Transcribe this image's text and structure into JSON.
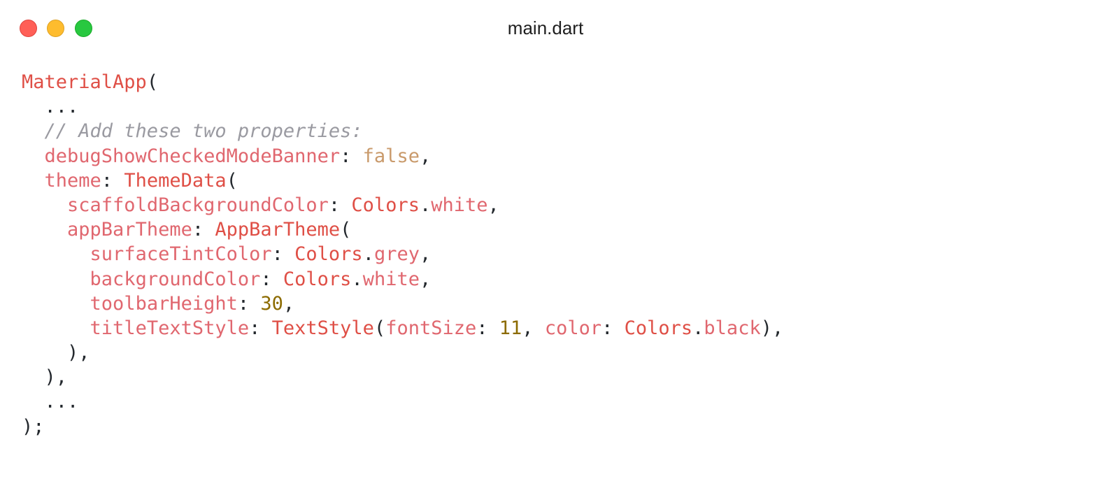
{
  "window": {
    "title": "main.dart"
  },
  "colors": {
    "close": "#ff5f57",
    "minimize": "#febc2e",
    "zoom": "#28c840",
    "class": "#df4f46",
    "property": "#e0676f",
    "comment": "#9a9aa1",
    "boolean": "#c99a6b",
    "number": "#8c6b00",
    "plain": "#24292e"
  },
  "code": {
    "lines": [
      [
        {
          "t": "MaterialApp",
          "c": "class"
        },
        {
          "t": "(",
          "c": "plain"
        }
      ],
      [
        {
          "t": "  ...",
          "c": "plain"
        }
      ],
      [
        {
          "t": "  // Add these two properties:",
          "c": "comment"
        }
      ],
      [
        {
          "t": "  ",
          "c": "plain"
        },
        {
          "t": "debugShowCheckedModeBanner",
          "c": "prop"
        },
        {
          "t": ": ",
          "c": "plain"
        },
        {
          "t": "false",
          "c": "bool"
        },
        {
          "t": ",",
          "c": "plain"
        }
      ],
      [
        {
          "t": "  ",
          "c": "plain"
        },
        {
          "t": "theme",
          "c": "prop"
        },
        {
          "t": ": ",
          "c": "plain"
        },
        {
          "t": "ThemeData",
          "c": "class"
        },
        {
          "t": "(",
          "c": "plain"
        }
      ],
      [
        {
          "t": "    ",
          "c": "plain"
        },
        {
          "t": "scaffoldBackgroundColor",
          "c": "prop"
        },
        {
          "t": ": ",
          "c": "plain"
        },
        {
          "t": "Colors",
          "c": "class"
        },
        {
          "t": ".",
          "c": "plain"
        },
        {
          "t": "white",
          "c": "member"
        },
        {
          "t": ",",
          "c": "plain"
        }
      ],
      [
        {
          "t": "    ",
          "c": "plain"
        },
        {
          "t": "appBarTheme",
          "c": "prop"
        },
        {
          "t": ": ",
          "c": "plain"
        },
        {
          "t": "AppBarTheme",
          "c": "class"
        },
        {
          "t": "(",
          "c": "plain"
        }
      ],
      [
        {
          "t": "      ",
          "c": "plain"
        },
        {
          "t": "surfaceTintColor",
          "c": "prop"
        },
        {
          "t": ": ",
          "c": "plain"
        },
        {
          "t": "Colors",
          "c": "class"
        },
        {
          "t": ".",
          "c": "plain"
        },
        {
          "t": "grey",
          "c": "member"
        },
        {
          "t": ",",
          "c": "plain"
        }
      ],
      [
        {
          "t": "      ",
          "c": "plain"
        },
        {
          "t": "backgroundColor",
          "c": "prop"
        },
        {
          "t": ": ",
          "c": "plain"
        },
        {
          "t": "Colors",
          "c": "class"
        },
        {
          "t": ".",
          "c": "plain"
        },
        {
          "t": "white",
          "c": "member"
        },
        {
          "t": ",",
          "c": "plain"
        }
      ],
      [
        {
          "t": "      ",
          "c": "plain"
        },
        {
          "t": "toolbarHeight",
          "c": "prop"
        },
        {
          "t": ": ",
          "c": "plain"
        },
        {
          "t": "30",
          "c": "num"
        },
        {
          "t": ",",
          "c": "plain"
        }
      ],
      [
        {
          "t": "      ",
          "c": "plain"
        },
        {
          "t": "titleTextStyle",
          "c": "prop"
        },
        {
          "t": ": ",
          "c": "plain"
        },
        {
          "t": "TextStyle",
          "c": "class"
        },
        {
          "t": "(",
          "c": "plain"
        },
        {
          "t": "fontSize",
          "c": "prop"
        },
        {
          "t": ": ",
          "c": "plain"
        },
        {
          "t": "11",
          "c": "num"
        },
        {
          "t": ", ",
          "c": "plain"
        },
        {
          "t": "color",
          "c": "prop"
        },
        {
          "t": ": ",
          "c": "plain"
        },
        {
          "t": "Colors",
          "c": "class"
        },
        {
          "t": ".",
          "c": "plain"
        },
        {
          "t": "black",
          "c": "member"
        },
        {
          "t": "),",
          "c": "plain"
        }
      ],
      [
        {
          "t": "    ),",
          "c": "plain"
        }
      ],
      [
        {
          "t": "  ),",
          "c": "plain"
        }
      ],
      [
        {
          "t": "  ...",
          "c": "plain"
        }
      ],
      [
        {
          "t": ");",
          "c": "plain"
        }
      ]
    ]
  }
}
